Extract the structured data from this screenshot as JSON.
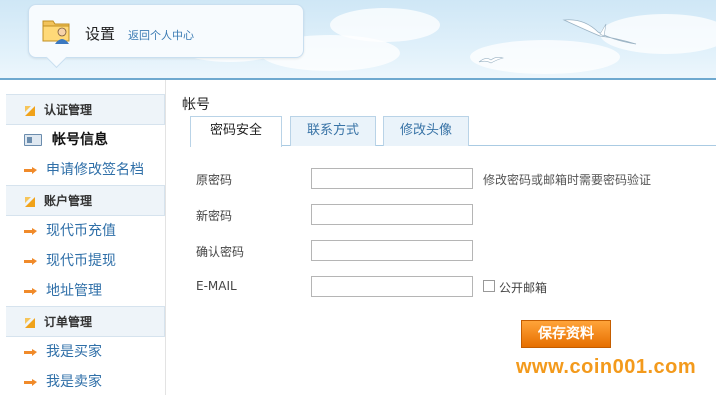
{
  "header": {
    "title": "设置",
    "back_link": "返回个人中心"
  },
  "sidebar": {
    "groups": [
      {
        "label": "认证管理",
        "items": [
          "帐号信息",
          "申请修改签名档"
        ]
      },
      {
        "label": "账户管理",
        "items": [
          "现代币充值",
          "现代币提现",
          "地址管理"
        ]
      },
      {
        "label": "订单管理",
        "items": [
          "我是买家",
          "我是卖家"
        ]
      }
    ],
    "active_item": "帐号信息"
  },
  "main": {
    "title": "帐号",
    "tabs": [
      {
        "label": "密码安全",
        "active": true
      },
      {
        "label": "联系方式",
        "active": false
      },
      {
        "label": "修改头像",
        "active": false
      }
    ],
    "form": {
      "password_label": "原密码",
      "password_hint": "修改密码或邮箱时需要密码验证",
      "new_password_label": "新密码",
      "confirm_password_label": "确认密码",
      "email_label": "E-MAIL",
      "public_email_label": "公开邮箱",
      "save_label": "保存资料"
    }
  },
  "watermark": "www.coin001.com",
  "colors": {
    "link": "#2f6fa8",
    "tab_border": "#b9d3e7",
    "save_button": "#e66f00",
    "watermark": "#f39a1c"
  }
}
